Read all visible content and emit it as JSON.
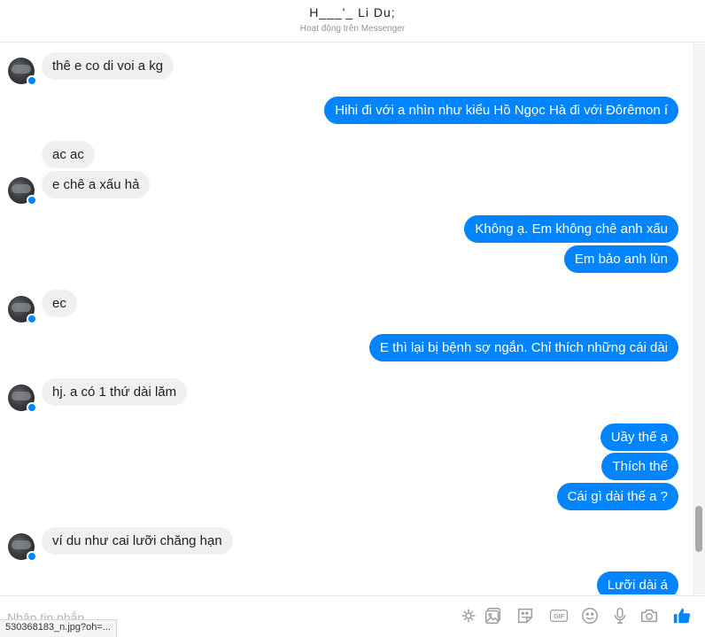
{
  "header": {
    "name": "H___'_ Li Du;",
    "status": "Hoạt động trên Messenger"
  },
  "messages": [
    {
      "side": "in",
      "text": "thê e co di voi a kg"
    },
    {
      "side": "out",
      "text": "Hihi đi với a nhìn như kiểu Hồ Ngọc Hà đi với Đôrêmon í"
    },
    {
      "side": "in",
      "text": "ac ac"
    },
    {
      "side": "in",
      "text": "e chê a xấu hả"
    },
    {
      "side": "out",
      "text": "Không ạ. Em không chê anh xấu"
    },
    {
      "side": "out",
      "text": "Em bảo anh lùn"
    },
    {
      "side": "in",
      "text": "ec"
    },
    {
      "side": "out",
      "text": "E thì lại bị bệnh sợ ngắn. Chỉ thích những cái dài"
    },
    {
      "side": "in",
      "text": "hj. a có 1 thứ dài lăm"
    },
    {
      "side": "out",
      "text": "Uầy thế ạ"
    },
    {
      "side": "out",
      "text": "Thích thế"
    },
    {
      "side": "out",
      "text": "Cái gì dài thế a ?"
    },
    {
      "side": "in",
      "text": "ví du như cai lưỡi chăng hạn"
    },
    {
      "side": "out",
      "text": "Lưỡi dài á"
    }
  ],
  "composer": {
    "placeholder": "Nhập tin nhắn...",
    "tools": [
      "emoji-sticker-icon",
      "image-icon",
      "sticker-icon",
      "gif-icon",
      "smiley-icon",
      "microphone-icon",
      "camera-icon",
      "thumbs-up-icon"
    ],
    "gif_label": "GIF"
  },
  "status_url": "530368183_n.jpg?oh=...",
  "colors": {
    "outgoing": "#0084ff",
    "incoming": "#f1f0f0",
    "like": "#0084ff"
  }
}
